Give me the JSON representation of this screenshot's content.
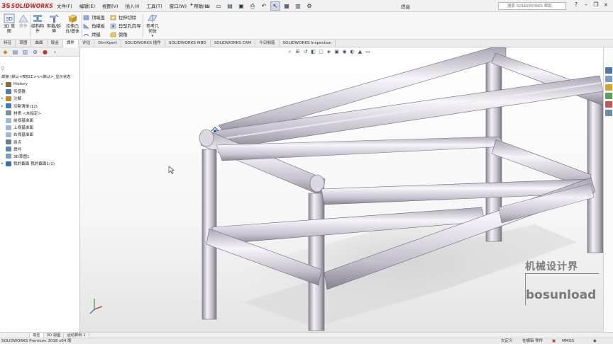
{
  "app": {
    "logo_ds": "3S",
    "logo_text": "SOLIDWORKS",
    "doc_title": "焊接",
    "menus": [
      "文件(F)",
      "编辑(E)",
      "视图(V)",
      "插入(I)",
      "工具(T)",
      "窗口(W)",
      "帮助(H)"
    ],
    "search_placeholder": "搜索 SOLIDWORKS 帮助"
  },
  "ribbon": {
    "sketch3d": "3D 草图",
    "weldment": "焊件",
    "structural_member": "结构构件",
    "trim_extend": "剪裁/延伸",
    "extruded_boss": "拉伸凸台/基体",
    "end_cap": "顶端盖",
    "gusset": "角撑板",
    "weld_bead": "焊缝",
    "extruded_cut": "拉伸切除",
    "hole_wizard": "异型孔向导",
    "chamfer": "倒角",
    "reference_geometry": "参考几何体"
  },
  "tabs": [
    {
      "label": "特征",
      "active": false
    },
    {
      "label": "草图",
      "active": false
    },
    {
      "label": "曲面",
      "active": false
    },
    {
      "label": "钣金",
      "active": false
    },
    {
      "label": "焊件",
      "active": true
    },
    {
      "label": "评估",
      "active": false
    },
    {
      "label": "DimXpert",
      "active": false
    },
    {
      "label": "SOLIDWORKS 插件",
      "active": false
    },
    {
      "label": "SOLIDWORKS MBD",
      "active": false
    },
    {
      "label": "SOLIDWORKS CAM",
      "active": false
    },
    {
      "label": "今日制造",
      "active": false
    },
    {
      "label": "SOLIDWORKS Inspection",
      "active": false
    }
  ],
  "feature_tree": {
    "part_name": "焊接 (默认<按加工><<默认>_显示状态",
    "items": [
      {
        "label": "History",
        "icon": "history-icon",
        "color": "#8a6d3b",
        "toggle": "▸"
      },
      {
        "label": "传感器",
        "icon": "sensor-icon",
        "color": "#4f7cae",
        "toggle": ""
      },
      {
        "label": "注解",
        "icon": "annotation-icon",
        "color": "#c48b1e",
        "toggle": "▸"
      },
      {
        "label": "切割清单(12)",
        "icon": "cut-list-icon",
        "color": "#3f7ac0",
        "toggle": "▸"
      },
      {
        "label": "材质 <未指定>",
        "icon": "material-icon",
        "color": "#7f8c99",
        "toggle": ""
      },
      {
        "label": "前视基准面",
        "icon": "plane-icon",
        "color": "#9db8d8",
        "toggle": ""
      },
      {
        "label": "上视基准面",
        "icon": "plane-icon",
        "color": "#9db8d8",
        "toggle": ""
      },
      {
        "label": "右视基准面",
        "icon": "plane-icon",
        "color": "#9db8d8",
        "toggle": ""
      },
      {
        "label": "原点",
        "icon": "origin-icon",
        "color": "#6a7f93",
        "toggle": ""
      },
      {
        "label": "焊件",
        "icon": "weldment-icon",
        "color": "#5f86b3",
        "toggle": ""
      },
      {
        "label": "3D草图1",
        "icon": "sketch3d-icon",
        "color": "#7a9cc6",
        "toggle": ""
      },
      {
        "label": "我的截面 我的截面1(1)",
        "icon": "structural-member-icon",
        "color": "#3d6fa8",
        "toggle": "▸"
      }
    ]
  },
  "bottom_tabs": [
    {
      "label": "模型",
      "active": true
    },
    {
      "label": "3D 视图",
      "active": false
    },
    {
      "label": "运动算例 1",
      "active": false
    }
  ],
  "status": {
    "product": "SOLIDWORKS Premium 2018 x64 版",
    "definition": "欠定义",
    "editing": "在编辑 零件",
    "units": "MMGS"
  },
  "watermark": {
    "line1": "机械设计界",
    "line2": "bosunload"
  }
}
